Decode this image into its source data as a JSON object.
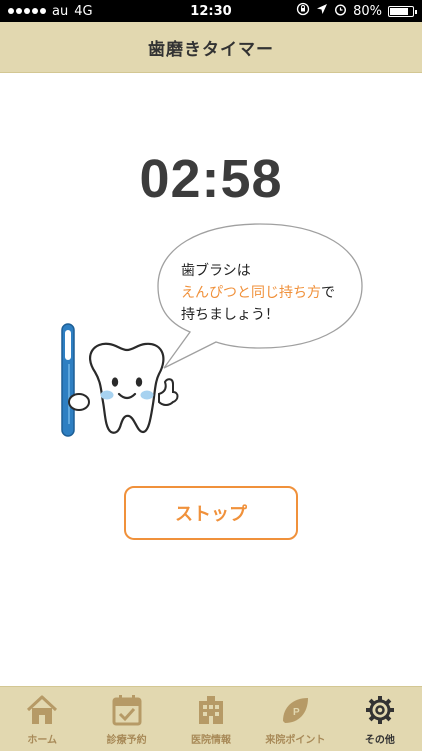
{
  "status_bar": {
    "carrier": "au",
    "network": "4G",
    "time": "12:30",
    "battery": "80%",
    "battery_level": 0.8
  },
  "header": {
    "title": "歯磨きタイマー"
  },
  "timer": {
    "value": "02:58"
  },
  "bubble": {
    "line1": "歯ブラシは",
    "line2_highlight": "えんぴつと同じ持ち方",
    "line2_rest": "で",
    "line3": "持ちましょう！"
  },
  "stop_button": {
    "label": "ストップ"
  },
  "tabbar": {
    "items": [
      {
        "label": "ホーム",
        "icon": "home-icon"
      },
      {
        "label": "診療予約",
        "icon": "calendar-check-icon"
      },
      {
        "label": "医院情報",
        "icon": "building-icon"
      },
      {
        "label": "来院ポイント",
        "icon": "point-leaf-icon"
      },
      {
        "label": "その他",
        "icon": "gear-icon"
      }
    ],
    "active_index": 4
  },
  "colors": {
    "accent": "#f0913b",
    "bar_background": "#e2d8b0",
    "tab_icon": "#b69a66"
  }
}
